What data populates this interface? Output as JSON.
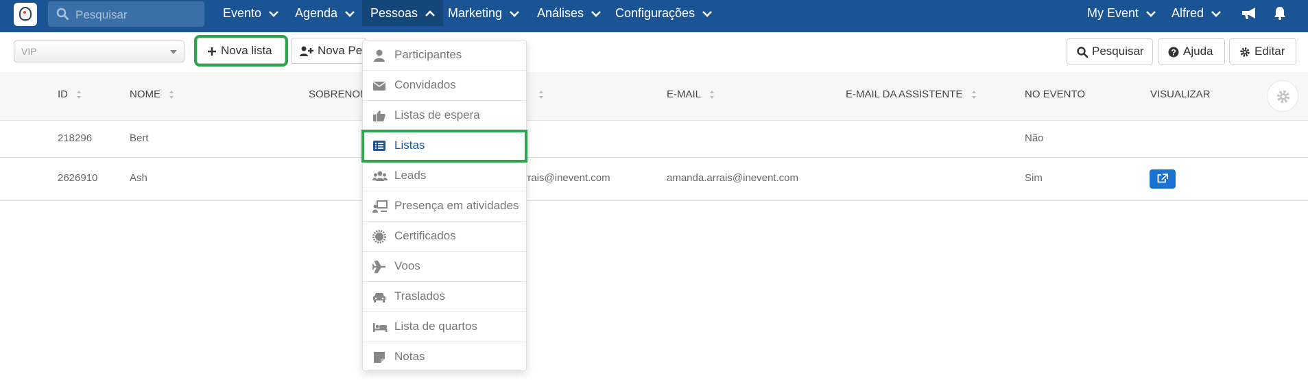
{
  "nav": {
    "search_placeholder": "Pesquisar",
    "items": [
      {
        "label": "Evento"
      },
      {
        "label": "Agenda"
      },
      {
        "label": "Pessoas"
      },
      {
        "label": "Marketing"
      },
      {
        "label": "Análises"
      },
      {
        "label": "Configurações"
      }
    ],
    "right": [
      {
        "label": "My Event"
      },
      {
        "label": "Alfred"
      }
    ],
    "active_item": "Pessoas"
  },
  "toolbar": {
    "select_value": "VIP",
    "new_list_label": "Nova lista",
    "new_person_label": "Nova Pessoa",
    "search_label": "Pesquisar",
    "help_label": "Ajuda",
    "edit_label": "Editar"
  },
  "table": {
    "headers": [
      "ID",
      "NOME",
      "SOBRENOME",
      "E-MAIL",
      "E-MAIL DA ASSISTENTE",
      "NO EVENTO",
      "VISUALIZAR"
    ],
    "rows": [
      {
        "id": "218296",
        "name": "Bert",
        "username": "",
        "email": "",
        "assistant_email": "",
        "at_event": "Não"
      },
      {
        "id": "2626910",
        "name": "Ash",
        "username": "arrais@inevent.com",
        "email": "amanda.arrais@inevent.com",
        "assistant_email": "",
        "at_event": "Sim"
      }
    ]
  },
  "dropdown": {
    "items": [
      {
        "label": "Participantes",
        "icon": "user-icon"
      },
      {
        "label": "Convidados",
        "icon": "envelope-icon"
      },
      {
        "label": "Listas de espera",
        "icon": "thumbs-up-icon"
      },
      {
        "label": "Listas",
        "icon": "list-icon"
      },
      {
        "label": "Leads",
        "icon": "users-icon"
      },
      {
        "label": "Presença em atividades",
        "icon": "presentation-icon"
      },
      {
        "label": "Certificados",
        "icon": "certificate-icon"
      },
      {
        "label": "Voos",
        "icon": "plane-icon"
      },
      {
        "label": "Traslados",
        "icon": "car-icon"
      },
      {
        "label": "Lista de quartos",
        "icon": "bed-icon"
      },
      {
        "label": "Notas",
        "icon": "note-icon"
      }
    ],
    "selected": "Listas"
  },
  "colors": {
    "nav_bg": "#1a5495",
    "highlight": "#2ea44f",
    "view_button": "#1a73d0"
  }
}
